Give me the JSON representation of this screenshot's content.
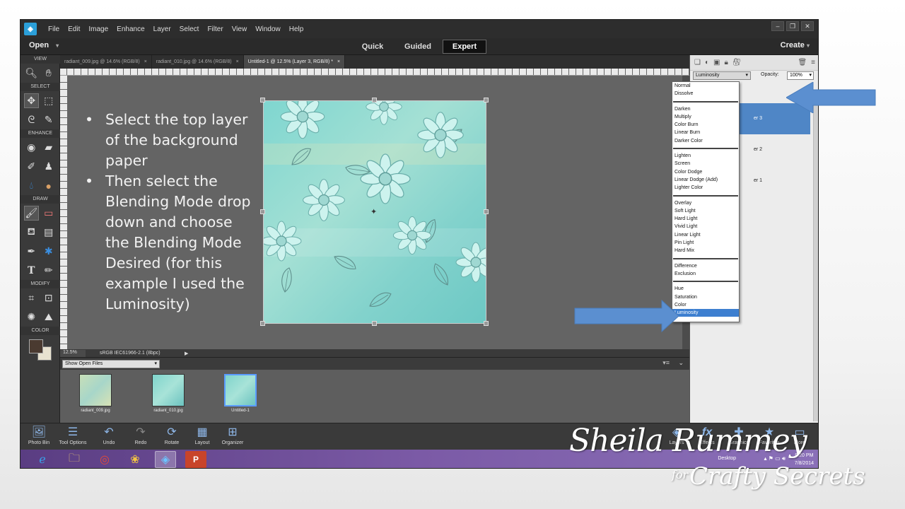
{
  "menu": [
    "File",
    "Edit",
    "Image",
    "Enhance",
    "Layer",
    "Select",
    "Filter",
    "View",
    "Window",
    "Help"
  ],
  "window_controls": [
    "–",
    "❐",
    "✕"
  ],
  "modebar": {
    "open": "Open",
    "tabs": [
      "Quick",
      "Guided",
      "Expert"
    ],
    "create": "Create"
  },
  "toolbox": {
    "sections": [
      "VIEW",
      "SELECT",
      "ENHANCE",
      "DRAW",
      "MODIFY",
      "COLOR"
    ]
  },
  "doc_tabs": [
    {
      "label": "radiant_009.jpg @ 14.6% (RGB/8)",
      "close": "×"
    },
    {
      "label": "radiant_010.jpg @ 14.6% (RGB/8)",
      "close": "×"
    },
    {
      "label": "Untitled-1 @ 12.5% (Layer 3, RGB/8) *",
      "close": "×"
    }
  ],
  "status": {
    "zoom": "12.5%",
    "profile": "sRGB IEC61966-2.1 (8bpc)"
  },
  "layers": {
    "blend_mode": "Luminosity",
    "opacity_label": "Opacity:",
    "opacity_value": "100%",
    "names": [
      "er 3",
      "er 2",
      "er 1"
    ]
  },
  "blend_menu": {
    "groups": [
      [
        "Normal",
        "Dissolve"
      ],
      [
        "Darken",
        "Multiply",
        "Color Burn",
        "Linear Burn",
        "Darker Color"
      ],
      [
        "Lighten",
        "Screen",
        "Color Dodge",
        "Linear Dodge (Add)",
        "Lighter Color"
      ],
      [
        "Overlay",
        "Soft Light",
        "Hard Light",
        "Vivid Light",
        "Linear Light",
        "Pin Light",
        "Hard Mix"
      ],
      [
        "Difference",
        "Exclusion"
      ],
      [
        "Hue",
        "Saturation",
        "Color",
        "Luminosity"
      ]
    ],
    "selected": "Luminosity"
  },
  "bin": {
    "dropdown": "Show Open Files",
    "items": [
      "radiant_009.jpg",
      "radiant_010.jpg",
      "Untitled-1"
    ]
  },
  "taskbar": [
    "Photo Bin",
    "Tool Options",
    "Undo",
    "Redo",
    "Rotate",
    "Layout",
    "Organizer",
    "Layers",
    "Effects",
    "Graphics",
    "Favorites",
    "More"
  ],
  "windows_taskbar": {
    "desktop": "Desktop",
    "time": "9:20 PM",
    "date": "7/8/2014"
  },
  "instructions": [
    "Select the top layer of the background paper",
    "Then select the Blending Mode drop down and choose the Blending Mode Desired (for this example I used the Luminosity)"
  ],
  "signature": {
    "name": "Sheila Rummey",
    "for": "for",
    "brand": "Crafty Secrets"
  },
  "colors": {
    "arrow": "#5b8fd0",
    "highlight": "#3d7fd0",
    "canvas_bg": "#646464",
    "paper": "#8fd8d0"
  }
}
